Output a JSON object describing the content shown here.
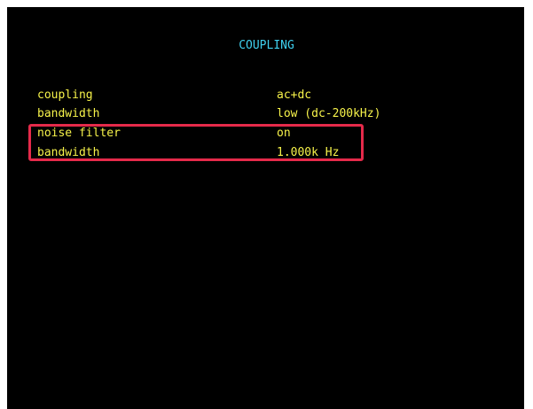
{
  "screen": {
    "title": "COUPLING",
    "settings": [
      {
        "label": "coupling",
        "value": "ac+dc"
      },
      {
        "label": "bandwidth",
        "value": "low (dc-200kHz)"
      },
      {
        "label": "noise filter",
        "value": "on"
      },
      {
        "label": "bandwidth",
        "value": "1.000k Hz"
      }
    ]
  },
  "colors": {
    "background": "#000000",
    "title": "#3fd0ef",
    "text": "#f7f34a",
    "highlight": "#e52a4a"
  }
}
